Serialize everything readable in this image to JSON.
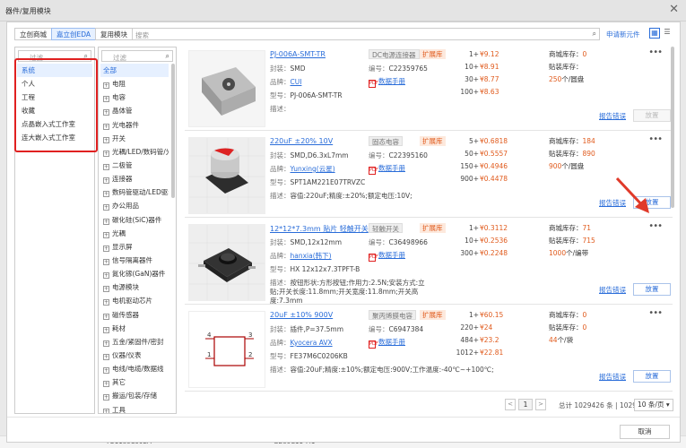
{
  "window": {
    "title": "器件/复用模块",
    "close_glyph": "✕"
  },
  "tabs": [
    {
      "label": "立创商城"
    },
    {
      "label": "嘉立创EDA"
    },
    {
      "label": "复用模块"
    }
  ],
  "search": {
    "placeholder": "搜索"
  },
  "request_link": "申请新元件",
  "library_panel": {
    "filter_placeholder": "过滤",
    "items": [
      "系统",
      "个人",
      "工程",
      "收藏",
      "点晶嵌入式工作室",
      "连大嵌入式工作室"
    ]
  },
  "category_panel": {
    "filter_placeholder": "过滤",
    "all_label": "全部",
    "items": [
      "电阻",
      "电容",
      "晶体管",
      "光电器件",
      "开关",
      "光耦/LED/数码管/光电",
      "二极管",
      "连接器",
      "数码管驱动/LED驱动",
      "办公用品",
      "碳化硅(SiC)器件",
      "光耦",
      "显示屏",
      "信号隔离器件",
      "氮化镓(GaN)器件",
      "电源模块",
      "电机驱动芯片",
      "磁传感器",
      "耗材",
      "五金/紧固件/密封",
      "仪器/仪表",
      "电线/电缆/数据线",
      "其它",
      "搬运/包装/存储",
      "工具"
    ]
  },
  "labels": {
    "package": "封装：",
    "brand": "品牌：",
    "mpn": "型号：",
    "desc": "描述：",
    "code": "编号：",
    "datasheet": "数据手册",
    "mall_stock": "商城库存：",
    "smt_stock": "贴装库存：",
    "report": "报告错误",
    "place": "放置",
    "pdf": "PDF"
  },
  "parts": [
    {
      "name": "PJ-006A-SMT-TR",
      "category": "DC电源连接器",
      "tag": "扩展库",
      "package": "SMD",
      "brand": "CUI",
      "mpn": "PJ-006A-SMT-TR",
      "desc": "",
      "code": "C22359765",
      "prices": [
        {
          "q": "1+",
          "p": "¥9.12"
        },
        {
          "q": "10+",
          "p": "¥8.91"
        },
        {
          "q": "30+",
          "p": "¥8.77"
        },
        {
          "q": "100+",
          "p": "¥8.63"
        }
      ],
      "mall_stock": "0",
      "smt_stock_value": "250",
      "smt_stock_unit": "个/圆盘",
      "place_enabled": false
    },
    {
      "name": "220uF ±20% 10V",
      "category": "固态电容",
      "tag": "扩展库",
      "package": "SMD,D6.3xL7mm",
      "brand": "Yunxing(云星)",
      "mpn": "SPT1AM221E07TRVZC",
      "desc": "容值:220uF;精度:±20%;额定电压:10V;",
      "code": "C22395160",
      "prices": [
        {
          "q": "5+",
          "p": "¥0.6818"
        },
        {
          "q": "50+",
          "p": "¥0.5557"
        },
        {
          "q": "150+",
          "p": "¥0.4946"
        },
        {
          "q": "900+",
          "p": "¥0.4478"
        }
      ],
      "mall_stock": "184",
      "smt_stock": "890",
      "smt_stock_value": "900",
      "smt_stock_unit": "个/圆盘",
      "place_enabled": true
    },
    {
      "name": "12*12*7.3mm 贴片 轻触开关",
      "category": "轻触开关",
      "tag": "扩展库",
      "package": "SMD,12x12mm",
      "brand": "hanxia(韩下)",
      "mpn": "HX 12x12x7.3TPFT-B",
      "desc": "按钮形状:方形按钮;作用力:2.5N;安装方式:立贴;开关长度:11.8mm;开关宽度:11.8mm;开关高度:7.3mm",
      "code": "C36498966",
      "prices": [
        {
          "q": "1+",
          "p": "¥0.3112"
        },
        {
          "q": "10+",
          "p": "¥0.2536"
        },
        {
          "q": "300+",
          "p": "¥0.2248"
        }
      ],
      "mall_stock": "71",
      "smt_stock": "715",
      "smt_stock_value": "1000",
      "smt_stock_unit": "个/编带",
      "place_enabled": true
    },
    {
      "name": "20uF ±10% 900V",
      "category": "聚丙烯膜电容",
      "tag": "扩展库",
      "package": "插件,P=37.5mm",
      "brand": "Kyocera AVX",
      "mpn": "FE37M6C0206KB",
      "desc": "容值:20uF;精度:±10%;额定电压:900V;工作温度:-40℃~+100℃;",
      "code": "C6947384",
      "prices": [
        {
          "q": "1+",
          "p": "¥60.15"
        },
        {
          "q": "220+",
          "p": "¥24"
        },
        {
          "q": "484+",
          "p": "¥23.2"
        },
        {
          "q": "1012+",
          "p": "¥22.81"
        }
      ],
      "mall_stock": "0",
      "smt_stock": "0",
      "smt_stock_value": "44",
      "smt_stock_unit": "个/袋",
      "place_enabled": true
    }
  ],
  "pagination": {
    "prev": "<",
    "page": "1",
    "next": ">",
    "total": "总计 1029426 条 | 102943 页",
    "page_size": "10 条/页 ▾"
  },
  "footer": {
    "cancel": "取消"
  },
  "background_row": [
    "TO1180C99LM",
    "GB00C11 7.1"
  ]
}
